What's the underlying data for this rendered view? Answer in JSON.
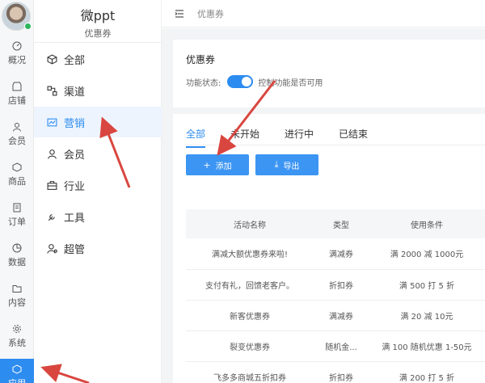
{
  "app": {
    "title": "微ppt",
    "subtitle": "优惠券"
  },
  "rail": [
    {
      "label": "概况",
      "icon": "dashboard-icon"
    },
    {
      "label": "店铺",
      "icon": "store-icon"
    },
    {
      "label": "会员",
      "icon": "user-icon"
    },
    {
      "label": "商品",
      "icon": "product-icon"
    },
    {
      "label": "订单",
      "icon": "order-icon"
    },
    {
      "label": "数据",
      "icon": "chart-icon"
    },
    {
      "label": "内容",
      "icon": "folder-icon"
    },
    {
      "label": "系统",
      "icon": "gear-icon"
    },
    {
      "label": "应用",
      "icon": "app-icon"
    }
  ],
  "submenu": [
    {
      "label": "全部",
      "icon": "cube-icon"
    },
    {
      "label": "渠道",
      "icon": "channel-icon"
    },
    {
      "label": "营销",
      "icon": "marketing-icon"
    },
    {
      "label": "会员",
      "icon": "member-icon"
    },
    {
      "label": "行业",
      "icon": "briefcase-icon"
    },
    {
      "label": "工具",
      "icon": "wrench-icon"
    },
    {
      "label": "超管",
      "icon": "admin-icon"
    }
  ],
  "topbar": {
    "breadcrumb": "优惠券"
  },
  "coupon": {
    "title": "优惠券",
    "status_label": "功能状态:",
    "status_hint": "控制功能是否可用",
    "enabled": true
  },
  "tabs": [
    "全部",
    "未开始",
    "进行中",
    "已结束"
  ],
  "buttons": {
    "add": "添加",
    "export": "导出"
  },
  "table": {
    "headers": [
      "活动名称",
      "类型",
      "使用条件"
    ],
    "rows": [
      [
        "满减大额优惠券来啦!",
        "满减券",
        "满 2000 减 1000元"
      ],
      [
        "支付有礼，回馈老客户。",
        "折扣券",
        "满 500 打 5 折"
      ],
      [
        "新客优惠券",
        "满减券",
        "满 20 减 10元"
      ],
      [
        "裂变优惠券",
        "随机金...",
        "满 100 随机优惠 1-50元"
      ],
      [
        "飞多多商城五折扣券",
        "折扣券",
        "满 200 打 5 折"
      ]
    ]
  },
  "colors": {
    "accent": "#2d8cf0",
    "annotation_arrow": "#d9463f"
  }
}
